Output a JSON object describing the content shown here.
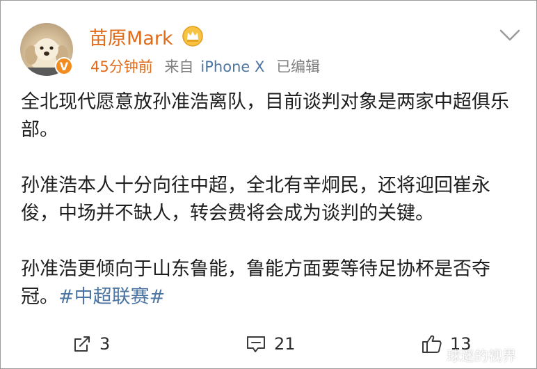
{
  "post": {
    "username": "苗原Mark",
    "time": "45分钟前",
    "source_prefix": "来自",
    "source": "iPhone X",
    "edited": "已编辑",
    "paragraphs": [
      "全北现代愿意放孙准浩离队，目前谈判对象是两家中超俱乐部。",
      "孙准浩本人十分向往中超，全北有辛炯民，还将迎回崔永俊，中场并不缺人，转会费将会成为谈判的关键。",
      "孙准浩更倾向于山东鲁能，鲁能方面要等待足协杯是否夺冠。"
    ],
    "hashtag": "#中超联赛#"
  },
  "actions": {
    "shares": "3",
    "comments": "21",
    "likes": "13"
  },
  "watermark": "球迷的视界",
  "icons": {
    "verified": "verified-v-icon",
    "crown": "crown-icon",
    "menu": "chevron-down-icon",
    "share": "share-icon",
    "comment": "comment-icon",
    "like": "thumbs-up-icon"
  },
  "colors": {
    "username": "#e06b1a",
    "link": "#4c75a3",
    "meta": "#808080",
    "verified_badge": "#f28c1e"
  }
}
